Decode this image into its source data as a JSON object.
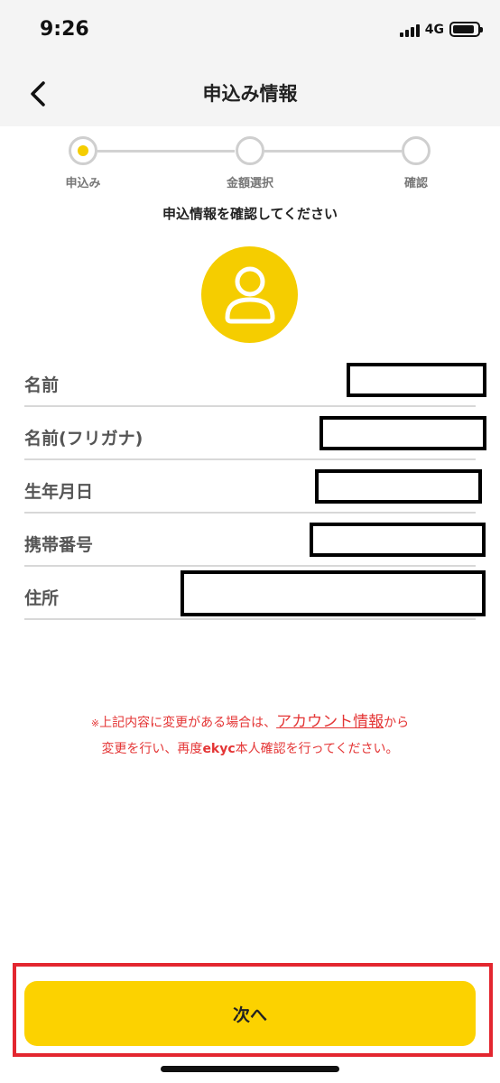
{
  "status_bar": {
    "time": "9:26",
    "network": "4G",
    "battery_level": 0.9
  },
  "nav": {
    "title": "申込み情報",
    "back_icon": "chevron-left-icon"
  },
  "stepper": {
    "steps": [
      {
        "label": "申込み",
        "active": true
      },
      {
        "label": "金額選択",
        "active": false
      },
      {
        "label": "確認",
        "active": false
      }
    ]
  },
  "instruction": "申込情報を確認してください",
  "avatar_icon": "user-icon",
  "info": {
    "rows": [
      {
        "label": "名前",
        "value": ""
      },
      {
        "label": "名前(フリガナ)",
        "value": ""
      },
      {
        "label": "生年月日",
        "value": ""
      },
      {
        "label": "携帯番号",
        "value": ""
      },
      {
        "label": "住所",
        "value": ""
      }
    ]
  },
  "notice": {
    "mark": "※",
    "line1_before": "上記内容に変更がある場合は、",
    "link": "アカウント情報",
    "line1_after": "から",
    "line2_before": "変更を行い、再度",
    "line2_bold": "ekyc",
    "line2_after": "本人確認を行ってください。"
  },
  "next_button": {
    "label": "次へ"
  },
  "colors": {
    "accent": "#fcd200",
    "notice": "#e43535",
    "highlight": "#e3262f"
  }
}
